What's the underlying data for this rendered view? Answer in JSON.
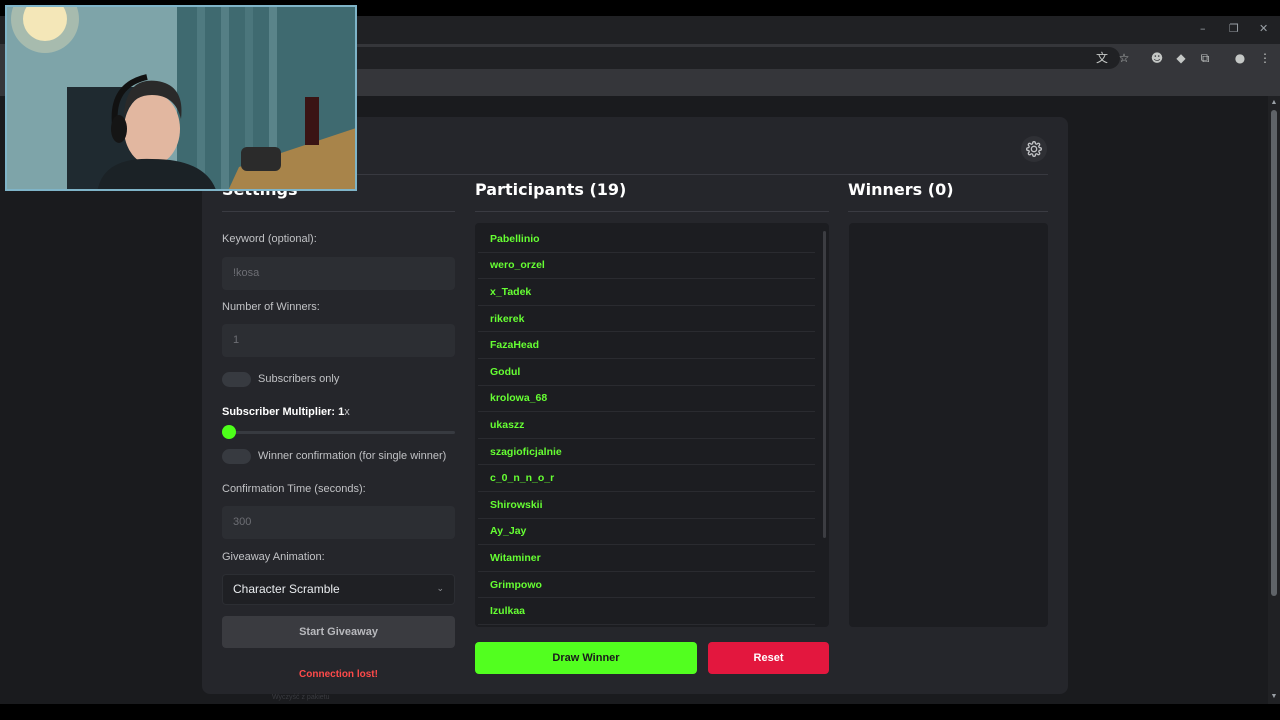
{
  "browser": {
    "window_controls": [
      "–",
      "❐",
      "✕"
    ],
    "toolbar_icons": [
      "translate-icon",
      "star-icon",
      "extension-icon",
      "shield-icon",
      "puzzle-icon",
      "profile-icon",
      "menu-icon"
    ]
  },
  "app": {
    "settings": {
      "title": "Settings",
      "keyword_label": "Keyword (optional):",
      "keyword_placeholder": "!kosa",
      "winners_label": "Number of Winners:",
      "winners_placeholder": "1",
      "subscribers_only_label": "Subscribers only",
      "multiplier_label": "Subscriber Multiplier: 1",
      "multiplier_suffix": "x",
      "multiplier_value": 1,
      "confirmation_toggle_label": "Winner confirmation (for single winner)",
      "confirmation_time_label": "Confirmation Time (seconds):",
      "confirmation_time_placeholder": "300",
      "animation_label": "Giveaway Animation:",
      "animation_value": "Character Scramble",
      "start_button": "Start Giveaway",
      "connection_status": "Connection lost!"
    },
    "participants": {
      "title": "Participants (19)",
      "items": [
        "Pabellinio",
        "wero_orzel",
        "x_Tadek",
        "rikerek",
        "FazaHead",
        "Godul",
        "krolowa_68",
        "ukaszz",
        "szagioficjalnie",
        "c_0_n_n_o_r",
        "Shirowskii",
        "Ay_Jay",
        "Witaminer",
        "Grimpowo",
        "Izulkaa"
      ]
    },
    "winners": {
      "title": "Winners (0)"
    },
    "draw_button": "Draw Winner",
    "reset_button": "Reset",
    "footer_note": "Wyczyść z pakietu"
  },
  "colors": {
    "accent_green": "#52ff1f",
    "participant_green": "#66ff33",
    "reset_red": "#e3173e",
    "error_red": "#ff4a4a",
    "card_bg": "#25262b",
    "page_bg": "#1a1b1e"
  }
}
